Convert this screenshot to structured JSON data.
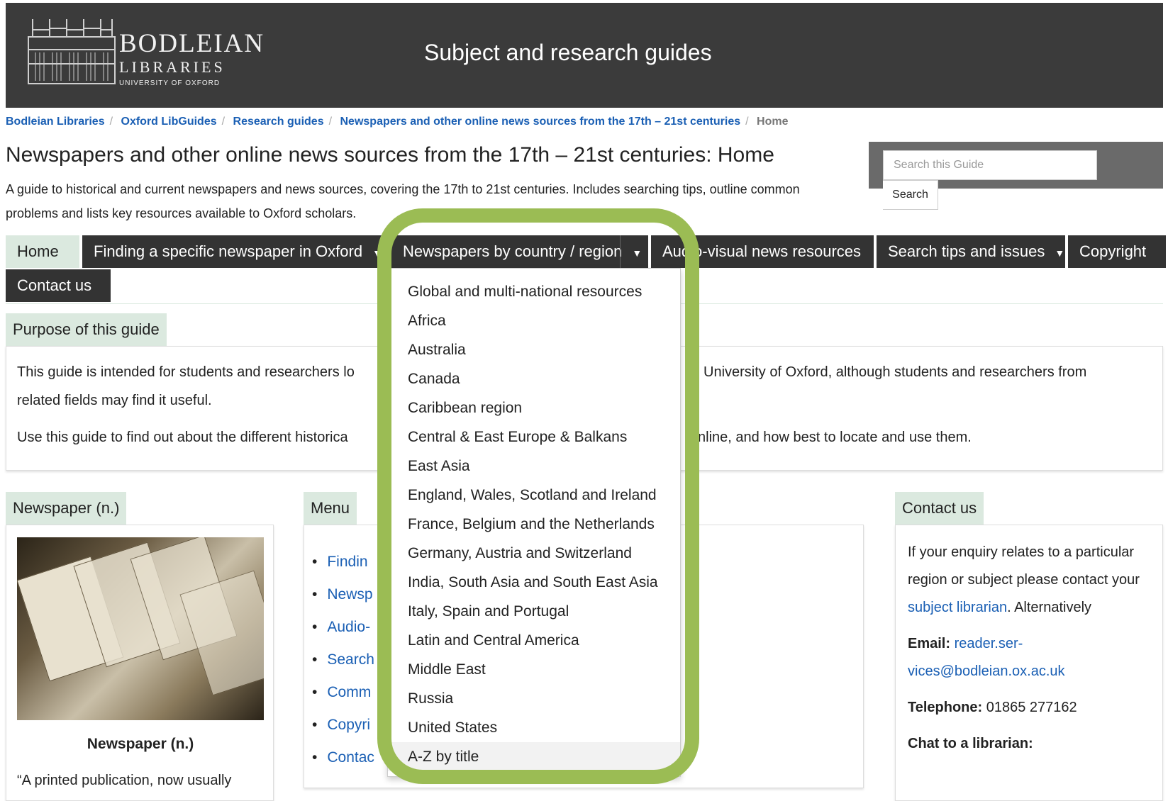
{
  "header": {
    "brand_line1": "BODLEIAN",
    "brand_line2": "LIBRARIES",
    "brand_line3": "UNIVERSITY OF OXFORD",
    "title": "Subject and research guides"
  },
  "breadcrumb": [
    "Bodleian Libraries",
    "Oxford LibGuides",
    "Research guides",
    "Newspapers and other online news sources from the 17th – 21st centuries",
    "Home"
  ],
  "page": {
    "title": "Newspapers and other online news sources from the 17th – 21st centuries: Home",
    "description": "A guide to historical and current newspapers and news sources, covering the 17th to 21st centuries. Includes searching tips, outline common problems and lists key resources available to Oxford scholars."
  },
  "search": {
    "placeholder": "Search this Guide",
    "button": "Search"
  },
  "tabs": [
    "Home",
    "Finding a specific newspaper in Oxford",
    "Newspapers by country / region",
    "Audio-visual news resources",
    "Search tips and issues",
    "Copyright",
    "Contact us"
  ],
  "purpose": {
    "title": "Purpose of this guide",
    "p1_a": "This guide is intended for students and researchers lo",
    "p1_b": "University of Oxford, although students and researchers from",
    "p1_c": "related fields may find it useful.",
    "p2_a": "Use this guide to find out about the different historica",
    "p2_b": "nline, and how best to locate and use them."
  },
  "newspaper": {
    "title": "Newspaper (n.)",
    "caption": "Newspaper (n.)",
    "quote": "“A printed publication, now usually"
  },
  "menu": {
    "title": "Menu",
    "items": [
      "Findin",
      "Newsp",
      "Audio-",
      "Search",
      "Comm",
      "Copyri",
      "Contac"
    ]
  },
  "contact": {
    "title": "Contact us",
    "text1": "If your enquiry relates to a particular region or subject please contact your",
    "link1": "subject librarian",
    "text2": ". Alternatively",
    "email_label": "Email:",
    "email": "reader.ser-vices@bodleian.ox.ac.uk",
    "phone_label": "Telephone:",
    "phone": "01865 277162",
    "chat_label": "Chat to a librarian:"
  },
  "dropdown": {
    "items": [
      "Global and multi-national resources",
      "Africa",
      "Australia",
      "Canada",
      "Caribbean region",
      "Central & East Europe & Balkans",
      "East Asia",
      "England, Wales, Scotland and Ireland",
      "France, Belgium and the Netherlands",
      "Germany, Austria and Switzerland",
      "India, South Asia and South East Asia",
      "Italy, Spain and Portugal",
      "Latin and Central America",
      "Middle East",
      "Russia",
      "United States",
      "A-Z by title"
    ]
  },
  "colors": {
    "header": "#3b3b3b",
    "accent_green": "#dbe9df",
    "highlight": "#9bbc54",
    "link": "#1a5fb4"
  }
}
